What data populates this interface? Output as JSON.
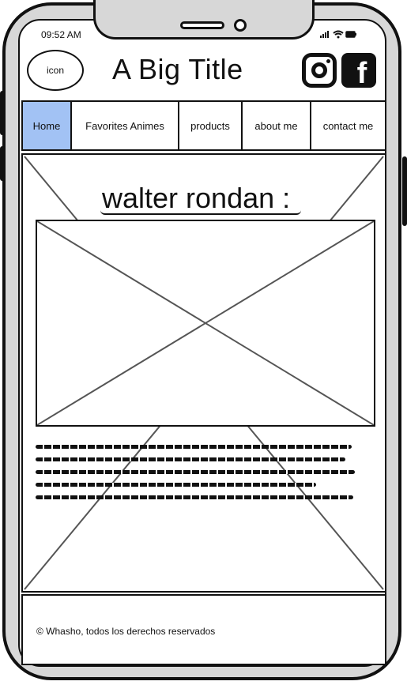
{
  "status_bar": {
    "time": "09:52 AM",
    "indicators": "signal wifi battery"
  },
  "header": {
    "logo_text": "icon",
    "title": "A Big Title",
    "social_icons": [
      "instagram-icon",
      "facebook-icon"
    ],
    "facebook_glyph": "f"
  },
  "nav": {
    "items": [
      {
        "label": "Home",
        "active": true
      },
      {
        "label": "Favorites Animes",
        "active": false
      },
      {
        "label": "products",
        "active": false
      },
      {
        "label": "about me",
        "active": false
      },
      {
        "label": "contact me",
        "active": false
      }
    ]
  },
  "main": {
    "heading": "walter rondan :",
    "image_placeholder": "image",
    "text_placeholder_lines": 5
  },
  "footer": {
    "text": "© Whasho, todos los derechos reservados"
  },
  "colors": {
    "active_nav": "#a2c2f4",
    "frame": "#111111",
    "device": "#d7d7d7"
  }
}
